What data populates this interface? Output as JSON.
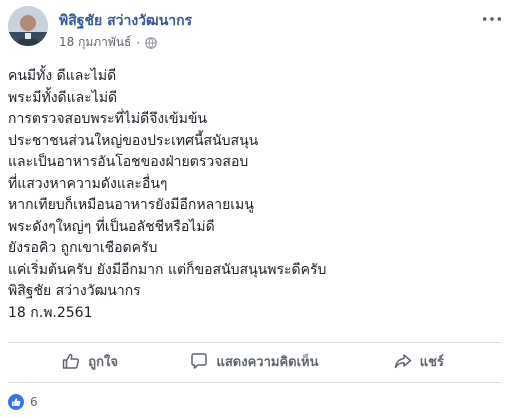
{
  "post": {
    "author_name": "พิสิฐชัย สว่างวัฒนากร",
    "date": "18 กุมภาพันธ์",
    "dot": "·",
    "privacy_icon": "globe-icon",
    "more_icon": "more-horizontal-icon",
    "body_lines": [
      "คนมีทั้ง ดีและไม่ดี",
      "พระมีทั้งดีและไม่ดี",
      "การตรวจสอบพระที่ไม่ดีจึงเข้มข้น",
      "ประชาชนส่วนใหญ่ของประเทศนี้สนับสนุน",
      "และเป็นอาหารอันโอชของฝ่ายตรวจสอบ",
      "ที่แสวงหาความดังและอื่นๆ",
      "หากเทียบก็เหมือนอาหารยังมีอีกหลายเมนู",
      "พระดังๆใหญ่ๆ ที่เป็นอลัชชีหรือไม่ดี",
      "ยังรอคิว ถูกเขาเชือดครับ",
      "แค่เริ่มต้นครับ ยังมีอีกมาก แต่ก็ขอสนับสนุนพระดีครับ",
      "พิสิฐชัย สว่างวัฒนากร",
      "18 ก.พ.2561"
    ]
  },
  "actions": {
    "like_label": "ถูกใจ",
    "comment_label": "แสดงความคิดเห็น",
    "share_label": "แชร์"
  },
  "reactions": {
    "count": "6",
    "icon": "like-reaction-icon"
  },
  "colors": {
    "author": "#385898",
    "text": "#1d2129",
    "muted": "#616770",
    "like_blue": "#3578e5",
    "divider": "#dadde1"
  }
}
